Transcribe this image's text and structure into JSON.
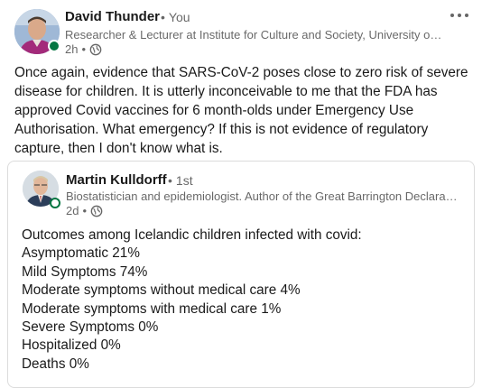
{
  "post": {
    "author": {
      "name": "David Thunder",
      "degree": "You",
      "headline": "Researcher & Lecturer at Institute for Culture and Society, University of Navarra",
      "time": "2h",
      "visibility_icon": "globe-icon",
      "avatar_icon": "profile-photo",
      "online_status_color": "#057642"
    },
    "more_icon": "ellipsis-icon",
    "text": "Once again, evidence that SARS-CoV-2 poses close to zero risk of severe disease for children. It is utterly inconceivable to me that the FDA has approved Covid vaccines for 6 month-olds under Emergency Use Authorisation. What emergency? If this is not evidence of regulatory capture, then I don't know what is."
  },
  "quoted": {
    "author": {
      "name": "Martin Kulldorff",
      "degree": "1st",
      "headline": "Biostatistician and epidemiologist. Author of the Great Barrington Declaration",
      "time": "2d",
      "visibility_icon": "globe-icon",
      "avatar_icon": "profile-photo"
    },
    "lines": [
      "Outcomes among Icelandic children infected with covid:",
      "Asymptomatic 21%",
      "Mild Symptoms 74%",
      "Moderate symptoms without medical care 4%",
      "Moderate symptoms with medical care 1%",
      "Severe Symptoms 0%",
      "Hospitalized 0%",
      "Deaths 0%"
    ]
  },
  "separator": "•"
}
